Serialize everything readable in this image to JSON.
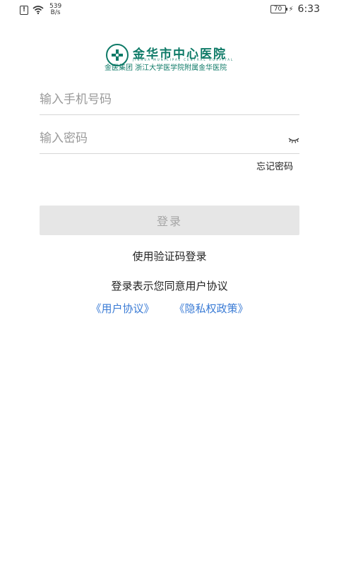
{
  "status_bar": {
    "alert_icon": "!",
    "net_speed_value": "539",
    "net_speed_unit": "B/s",
    "battery": "70",
    "charging_icon": "⚡",
    "time": "6:33"
  },
  "logo": {
    "name": "金华市中心医院",
    "pinyin": "JINHUA MUNICIPAL CENTRAL HOSPITAL",
    "subtitle": "金医集团 浙江大学医学院附属金华医院",
    "brand_color": "#0e7a67"
  },
  "form": {
    "phone_placeholder": "输入手机号码",
    "password_placeholder": "输入密码",
    "forgot_password": "忘记密码",
    "login_button": "登录",
    "sms_login": "使用验证码登录"
  },
  "agreement": {
    "text": "登录表示您同意用户协议",
    "user_agreement_link": "《用户协议》",
    "privacy_policy_link": "《隐私权政策》",
    "link_color": "#3a7bd5"
  }
}
